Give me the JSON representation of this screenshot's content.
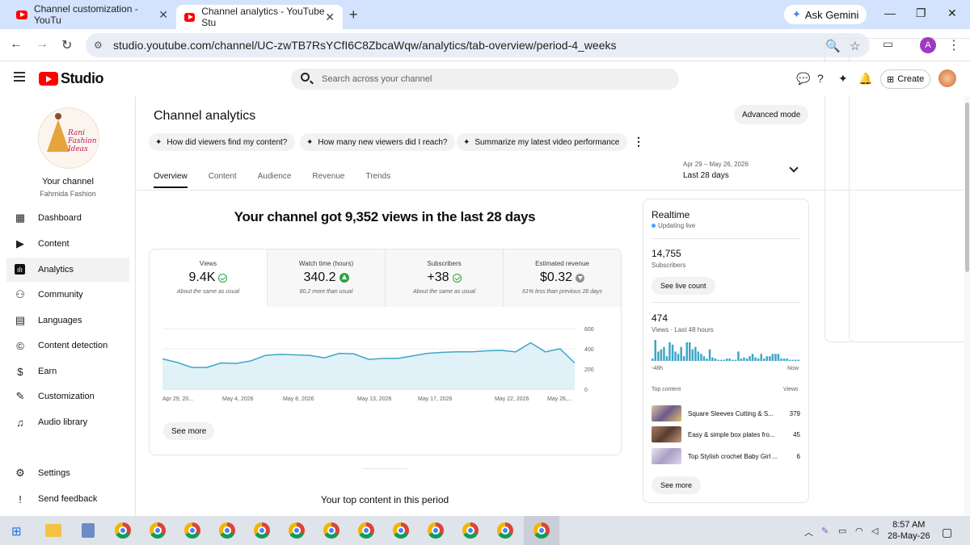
{
  "browser": {
    "tabs": [
      {
        "title": "Channel customization - YouTu",
        "close": "✕"
      },
      {
        "title": "Channel analytics - YouTube Stu",
        "close": "✕"
      }
    ],
    "new_tab": "+",
    "gemini": "Ask Gemini",
    "url": "studio.youtube.com/channel/UC-zwTB7RsYCfI6C8ZbcaWqw/analytics/tab-overview/period-4_weeks",
    "profile_initial": "A"
  },
  "studio": {
    "logo_text": "Studio",
    "search_placeholder": "Search across your channel",
    "create_label": "Create"
  },
  "sidebar": {
    "your_channel": "Your channel",
    "channel_name": "Fahmida Fashion",
    "logo_text": "Rani Fashion Ideas",
    "items": [
      {
        "label": "Dashboard",
        "icon": "dashboard-icon"
      },
      {
        "label": "Content",
        "icon": "content-icon"
      },
      {
        "label": "Analytics",
        "icon": "analytics-icon"
      },
      {
        "label": "Community",
        "icon": "community-icon"
      },
      {
        "label": "Languages",
        "icon": "languages-icon"
      },
      {
        "label": "Content detection",
        "icon": "copyright-icon"
      },
      {
        "label": "Earn",
        "icon": "earn-icon"
      },
      {
        "label": "Customization",
        "icon": "customization-icon"
      },
      {
        "label": "Audio library",
        "icon": "audio-library-icon"
      }
    ],
    "bottom": [
      {
        "label": "Settings",
        "icon": "gear-icon"
      },
      {
        "label": "Send feedback",
        "icon": "feedback-icon"
      }
    ]
  },
  "main": {
    "title": "Channel analytics",
    "advanced_mode": "Advanced mode",
    "chips": [
      "How did viewers find my content?",
      "How many new viewers did I reach?",
      "Summarize my latest video performance"
    ],
    "tabs": [
      "Overview",
      "Content",
      "Audience",
      "Revenue",
      "Trends"
    ],
    "date_range": "Apr 29 – May 26, 2026",
    "date_label": "Last 28 days",
    "headline": "Your channel got 9,352 views in the last 28 days",
    "metrics": [
      {
        "label": "Views",
        "value": "9.4K",
        "note": "About the same as usual",
        "status": "same"
      },
      {
        "label": "Watch time (hours)",
        "value": "340.2",
        "note": "80.2 more than usual",
        "status": "up"
      },
      {
        "label": "Subscribers",
        "value": "+38",
        "note": "About the same as usual",
        "status": "same"
      },
      {
        "label": "Estimated revenue",
        "value": "$0.32",
        "note": "61% less than previous 28 days",
        "status": "down"
      }
    ],
    "see_more": "See more",
    "top_content_title": "Your top content in this period"
  },
  "chart_data": {
    "type": "area",
    "x_tick_labels": [
      "Apr 29, 20...",
      "May 4, 2026",
      "May 8, 2026",
      "May 13, 2026",
      "May 17, 2026",
      "May 22, 2026",
      "May 26,..."
    ],
    "y_ticks": [
      0,
      200,
      400,
      600
    ],
    "ylim": [
      0,
      600
    ],
    "series": [
      {
        "values": [
          300,
          265,
          215,
          215,
          260,
          255,
          280,
          335,
          345,
          340,
          335,
          310,
          355,
          350,
          295,
          305,
          305,
          330,
          355,
          365,
          370,
          370,
          380,
          385,
          370,
          460,
          370,
          400,
          260
        ]
      }
    ],
    "line_color": "#3ea6c6",
    "fill_color": "#e1f1f8"
  },
  "realtime": {
    "title": "Realtime",
    "status": "Updating live",
    "subscribers": "14,755",
    "subscribers_label": "Subscribers",
    "see_live_count": "See live count",
    "views": "474",
    "views_label": "Views · Last 48 hours",
    "axis_left": "-48h",
    "axis_right": "Now",
    "top_content_label": "Top content",
    "views_col": "Views",
    "bars": [
      2,
      18,
      8,
      10,
      12,
      4,
      16,
      14,
      8,
      6,
      12,
      4,
      16,
      16,
      10,
      12,
      8,
      6,
      4,
      2,
      10,
      3,
      2,
      1,
      1,
      1,
      2,
      2,
      1,
      1,
      8,
      2,
      3,
      2,
      4,
      6,
      3,
      2,
      6,
      2,
      4,
      4,
      6,
      6,
      6,
      2,
      2,
      2,
      1,
      1,
      1,
      1
    ],
    "items": [
      {
        "title": "Square Sleeves Cutting & S...",
        "views": "379",
        "thumb": "#b89a7a"
      },
      {
        "title": "Easy & simple box plates fro...",
        "views": "45",
        "thumb": "#8c6b5a"
      },
      {
        "title": "Top Stylish crochet Baby Girl ...",
        "views": "6",
        "thumb": "#c8c4d8"
      }
    ],
    "see_more": "See more"
  },
  "taskbar": {
    "time": "8:57 AM",
    "date": "28-May-26"
  }
}
